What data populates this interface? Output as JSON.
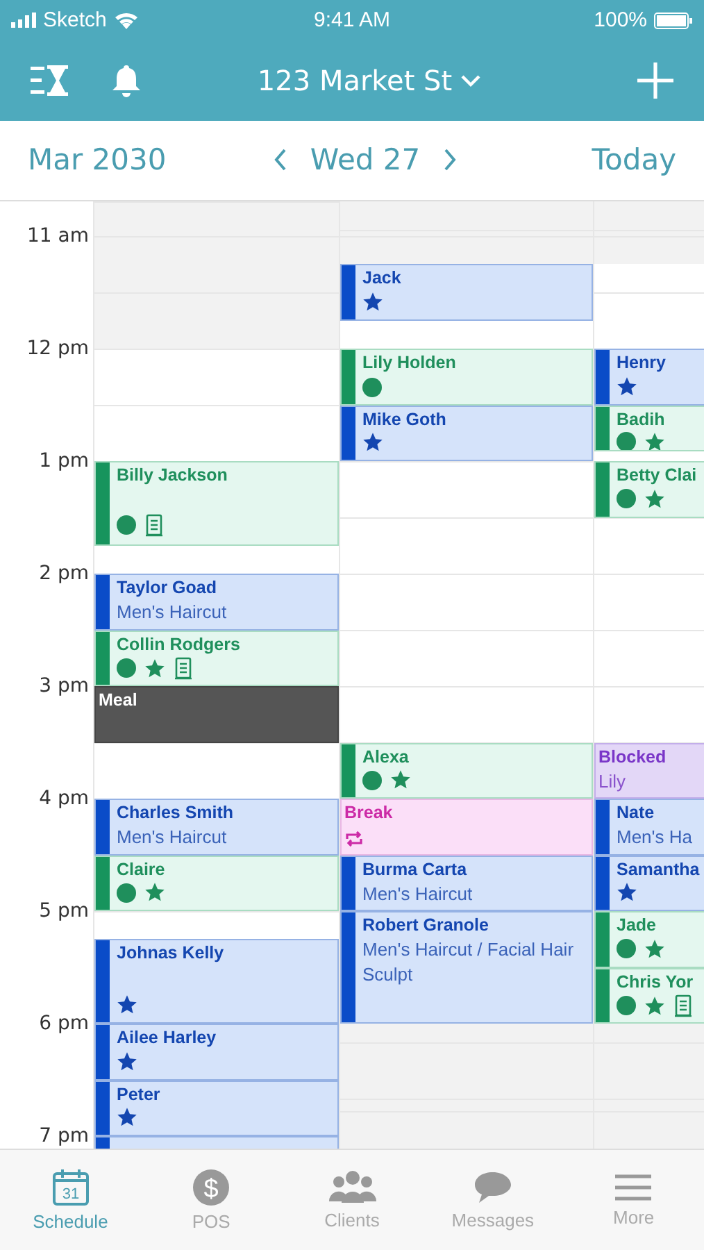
{
  "status_bar": {
    "carrier": "Sketch",
    "time": "9:41 AM",
    "battery": "100%"
  },
  "toolbar": {
    "title": "123 Market St"
  },
  "date_bar": {
    "month": "Mar 2030",
    "day": "Wed 27",
    "today": "Today"
  },
  "hours": [
    "11 am",
    "12 pm",
    "1 pm",
    "2 pm",
    "3 pm",
    "4 pm",
    "5 pm",
    "6 pm",
    "7 pm"
  ],
  "columns": [
    {
      "events": [
        {
          "kind": "confirmed",
          "name": "Billy Jackson",
          "marks": [
            {
              "kind": "dot"
            },
            {
              "kind": "notes"
            }
          ]
        },
        {
          "kind": "booked",
          "name": "Taylor Goad",
          "service": "Men's Haircut"
        },
        {
          "kind": "confirmed",
          "name": "Collin Rodgers",
          "marks": [
            {
              "kind": "dot"
            },
            {
              "kind": "star"
            },
            {
              "kind": "notes"
            }
          ]
        },
        {
          "kind": "meal",
          "name": "Meal"
        },
        {
          "kind": "booked",
          "name": "Charles Smith",
          "service": "Men's Haircut"
        },
        {
          "kind": "confirmed",
          "name": "Claire",
          "marks": [
            {
              "kind": "dot"
            },
            {
              "kind": "star"
            }
          ]
        },
        {
          "kind": "booked",
          "name": "Johnas Kelly",
          "marks": [
            {
              "kind": "star"
            }
          ]
        },
        {
          "kind": "booked",
          "name": "Ailee Harley",
          "marks": [
            {
              "kind": "star"
            }
          ]
        },
        {
          "kind": "booked",
          "name": "Peter",
          "marks": [
            {
              "kind": "star"
            }
          ]
        },
        {
          "kind": "booked"
        }
      ]
    },
    {
      "events": [
        {
          "kind": "booked",
          "name": "Jack",
          "marks": [
            {
              "kind": "star"
            }
          ]
        },
        {
          "kind": "confirmed",
          "name": "Lily Holden",
          "marks": [
            {
              "kind": "dot"
            }
          ]
        },
        {
          "kind": "booked",
          "name": "Mike Goth",
          "marks": [
            {
              "kind": "star"
            }
          ]
        },
        {
          "kind": "confirmed",
          "name": "Alexa",
          "marks": [
            {
              "kind": "dot"
            },
            {
              "kind": "star"
            }
          ]
        },
        {
          "kind": "break",
          "name": "Break",
          "marks": [
            {
              "kind": "repeat"
            }
          ]
        },
        {
          "kind": "booked",
          "name": "Burma Carta",
          "service": "Men's Haircut"
        },
        {
          "kind": "booked",
          "name": "Robert Granole",
          "service": "Men's Haircut / Facial Hair Sculpt"
        }
      ]
    },
    {
      "events": [
        {
          "kind": "booked",
          "name": "Henry",
          "marks": [
            {
              "kind": "star"
            }
          ]
        },
        {
          "kind": "confirmed",
          "name": "Badih",
          "marks": [
            {
              "kind": "dot"
            },
            {
              "kind": "star"
            }
          ]
        },
        {
          "kind": "confirmed",
          "name": "Betty Clai",
          "marks": [
            {
              "kind": "dot"
            },
            {
              "kind": "star"
            }
          ]
        },
        {
          "kind": "blocked",
          "name": "Blocked",
          "service": "Lily"
        },
        {
          "kind": "booked",
          "name": "Nate",
          "service": "Men's Ha"
        },
        {
          "kind": "booked",
          "name": "Samantha",
          "marks": [
            {
              "kind": "star"
            }
          ]
        },
        {
          "kind": "confirmed",
          "name": "Jade",
          "marks": [
            {
              "kind": "dot"
            },
            {
              "kind": "star"
            }
          ]
        },
        {
          "kind": "confirmed",
          "name": "Chris Yor",
          "marks": [
            {
              "kind": "dot"
            },
            {
              "kind": "star"
            },
            {
              "kind": "notes"
            }
          ]
        }
      ]
    }
  ],
  "tabs": [
    {
      "kind": "schedule",
      "label": "Schedule",
      "icon_text": "31",
      "selected": true
    },
    {
      "kind": "pos",
      "label": "POS",
      "icon_text": "$",
      "selected": false
    },
    {
      "kind": "clients",
      "label": "Clients",
      "selected": false
    },
    {
      "kind": "messages",
      "label": "Messages",
      "selected": false
    },
    {
      "kind": "more",
      "label": "More",
      "selected": false
    }
  ]
}
